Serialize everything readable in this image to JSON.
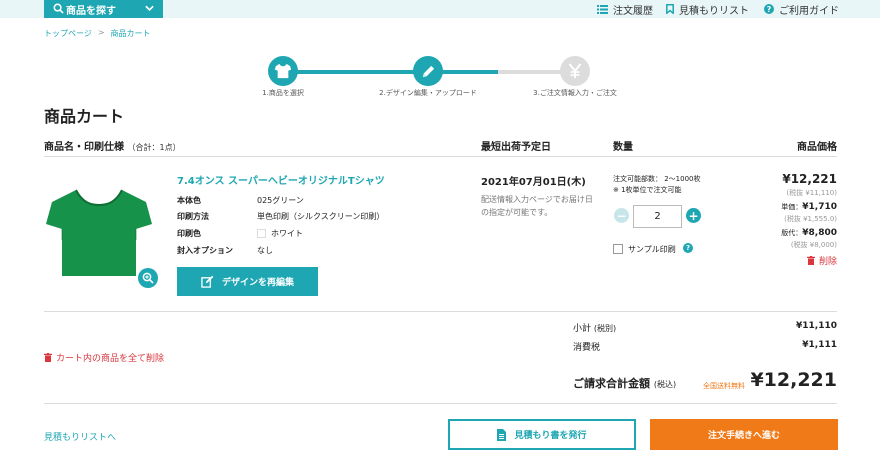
{
  "header": {
    "search_label": "商品を探す",
    "nav": {
      "history": "注文履歴",
      "estimate_list": "見積もりリスト",
      "guide": "ご利用ガイド"
    }
  },
  "breadcrumb": {
    "home": "トップページ",
    "sep": ">",
    "current": "商品カート"
  },
  "steps": [
    {
      "label": "1.商品を選択",
      "icon": "tshirt-icon"
    },
    {
      "label": "2.デザイン編集・アップロード",
      "icon": "pencil-icon"
    },
    {
      "label": "3.ご注文情報入力・ご注文",
      "icon": "yen-icon"
    }
  ],
  "page_title": "商品カート",
  "table": {
    "col_product": "商品名・印刷仕様",
    "col_product_count": "（合計：1点）",
    "col_ship": "最短出荷予定日",
    "col_qty": "数量",
    "col_price": "商品価格"
  },
  "item": {
    "name": "7.4オンス スーパーヘビーオリジナルTシャツ",
    "specs": [
      {
        "label": "本体色",
        "value": "025グリーン"
      },
      {
        "label": "印刷方法",
        "value": "単色印刷（シルクスクリーン印刷）"
      },
      {
        "label": "印刷色",
        "value": "ホワイト"
      },
      {
        "label": "封入オプション",
        "value": "なし"
      }
    ],
    "redesign_label": "デザインを再編集",
    "ship_date": "2021年07月01日(木)",
    "ship_note": "配送情報入力ページでお届け日の指定が可能です。",
    "qty_note1": "注文可能部数：  2〜1000枚",
    "qty_note2": "※ 1枚単位で注文可能",
    "qty_value": "2",
    "qty_minus": "−",
    "qty_plus": "+",
    "sample_label": "サンプル印刷",
    "help_mark": "?",
    "price_total": "¥12,221",
    "price_total_ex": "(税抜 ¥11,110)",
    "unit_label": "単価：",
    "unit_price": "¥1,710",
    "unit_price_ex": "(税抜 ¥1,555.0)",
    "plate_label": "版代：",
    "plate_price": "¥8,800",
    "plate_price_ex": "(税抜 ¥8,000)",
    "delete_label": "削除"
  },
  "clear_cart_label": "カート内の商品を全て削除",
  "summary": {
    "subtotal_label": "小計",
    "subtotal_tax_note": "(税別)",
    "subtotal_value": "¥11,110",
    "tax_label": "消費税",
    "tax_value": "¥1,111",
    "total_label": "ご請求合計金額",
    "total_tax_note": "(税込)",
    "free_shipping": "全国送料無料",
    "total_value": "¥12,221"
  },
  "footer": {
    "to_estimate_list": "見積もりリストへ",
    "issue_quote": "見積もり書を発行",
    "checkout": "注文手続きへ進む"
  },
  "colors": {
    "accent": "#1ea7b3",
    "orange": "#f07a18",
    "red": "#d9363e",
    "shirt": "#17924a"
  }
}
